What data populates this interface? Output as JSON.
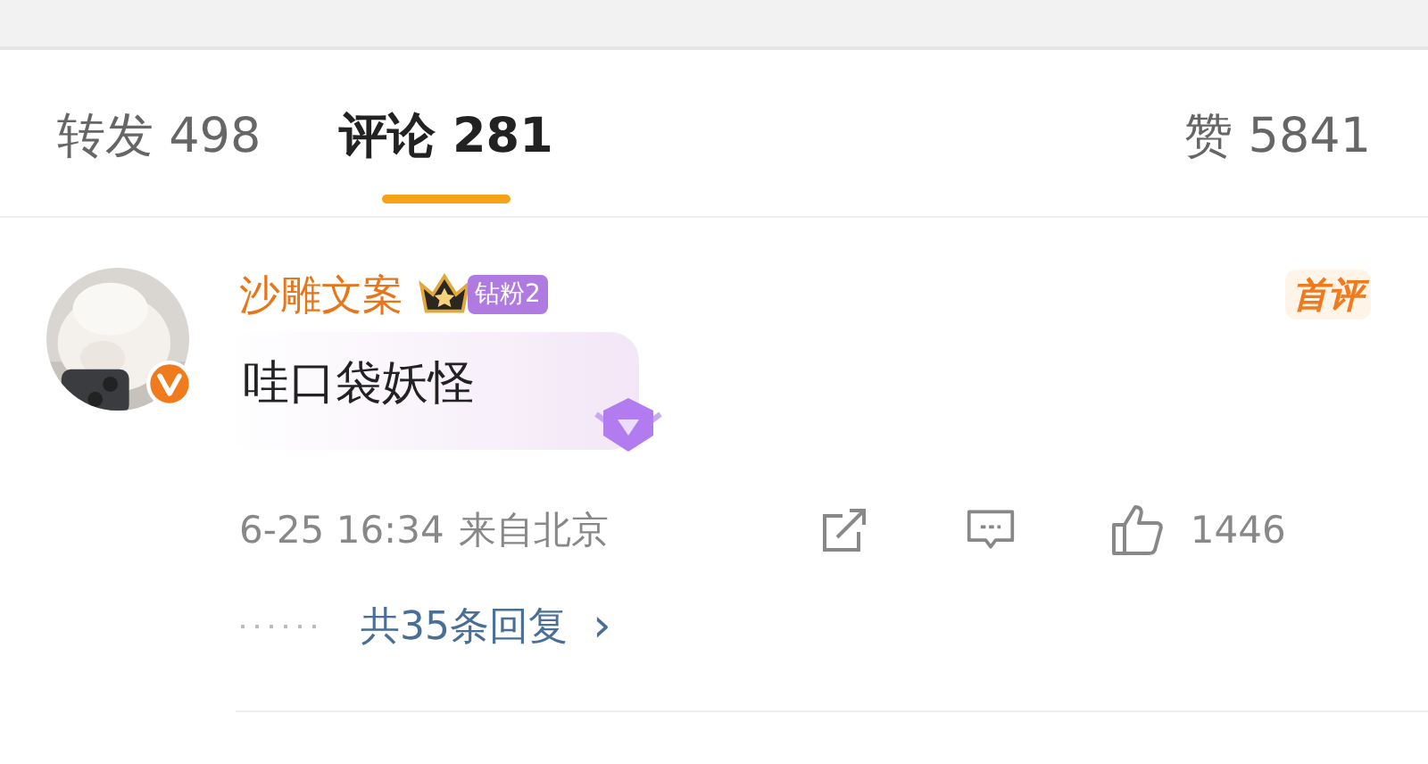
{
  "tabs": [
    {
      "label": "转发 498",
      "selected": false
    },
    {
      "label": "评论 281",
      "selected": true
    },
    {
      "label": "赞 5841",
      "selected": false
    }
  ],
  "comment": {
    "author": "沙雕文案",
    "verified": true,
    "fan_badge": "钻粉2",
    "text": "哇口袋妖怪",
    "tag": "首评",
    "time": "6-25 16:34",
    "location": "来自北京",
    "likes": "1446",
    "replies": "共35条回复",
    "replies_arrow": "›"
  }
}
